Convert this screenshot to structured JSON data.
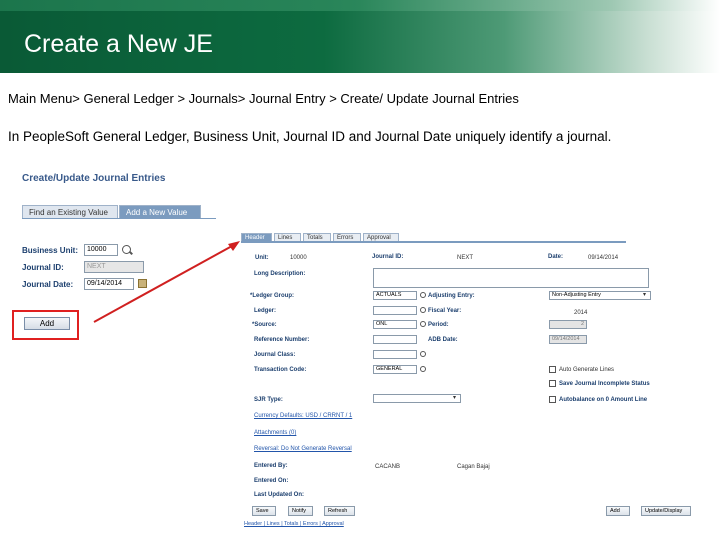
{
  "slide": {
    "title": "Create a New JE",
    "breadcrumb": "Main Menu> General Ledger > Journals> Journal Entry > Create/ Update Journal Entries",
    "intro": "In PeopleSoft General Ledger, Business Unit, Journal ID and Journal Date uniquely identify a journal."
  },
  "left_form": {
    "page_title": "Create/Update Journal Entries",
    "tabs": [
      "Find an Existing Value",
      "Add a New Value"
    ],
    "business_unit_label": "Business Unit:",
    "business_unit_value": "10000",
    "journal_id_label": "Journal ID:",
    "journal_id_value": "NEXT",
    "journal_date_label": "Journal Date:",
    "journal_date_value": "09/14/2014",
    "add_button": "Add"
  },
  "journal": {
    "tabs": [
      "Header",
      "Lines",
      "Totals",
      "Errors",
      "Approval"
    ],
    "unit_label": "Unit:",
    "unit_value": "10000",
    "journal_id_label": "Journal ID:",
    "journal_id_value": "NEXT",
    "date_label": "Date:",
    "date_value": "09/14/2014",
    "long_description_label": "Long Description:",
    "ledger_group_label": "*Ledger Group:",
    "ledger_group_value": "ACTUALS",
    "ledger_label": "Ledger:",
    "source_label": "*Source:",
    "source_value": "ONL",
    "reference_number_label": "Reference Number:",
    "journal_class_label": "Journal Class:",
    "transaction_code_label": "Transaction Code:",
    "transaction_code_value": "GENERAL",
    "adjusting_entry_label": "Adjusting Entry:",
    "adjusting_entry_value": "Non-Adjusting Entry",
    "fiscal_year_label": "Fiscal Year:",
    "fiscal_year_value": "2014",
    "period_label": "Period:",
    "period_value": "2",
    "adb_date_label": "ADB Date:",
    "adb_date_value": "09/14/2014",
    "checkbox_auto_generate": "Auto Generate Lines",
    "checkbox_save_incomplete": "Save Journal Incomplete Status",
    "checkbox_autobalance": "Autobalance on 0 Amount Line",
    "sjr_type_label": "SJR Type:",
    "currency_defaults_link": "Currency Defaults: USD / CRRNT / 1",
    "attachments_link": "Attachments (0)",
    "reversal_link": "Reversal: Do Not Generate Reversal",
    "entered_by_label": "Entered By:",
    "entered_by_value": "CACANB",
    "entered_by_name": "Cagan Bajaj",
    "entered_on_label": "Entered On:",
    "last_updated_label": "Last Updated On:",
    "buttons": {
      "save": "Save",
      "notify": "Notify",
      "refresh": "Refresh",
      "add": "Add",
      "update_display": "Update/Display"
    },
    "bottom_links": "Header | Lines | Totals | Errors | Approval"
  },
  "colors": {
    "banner": "#0d6b40",
    "highlight": "#e02020",
    "ps_tab": "#7b9bbf"
  }
}
